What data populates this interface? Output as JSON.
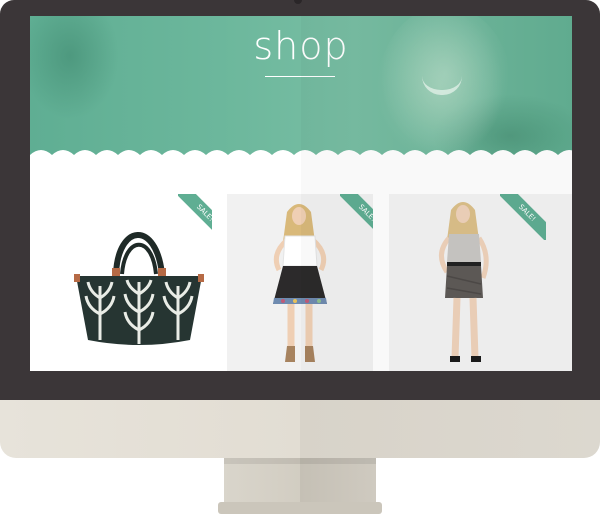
{
  "page": {
    "title": "shop"
  },
  "products": [
    {
      "name": "bag",
      "badge": "SALE!"
    },
    {
      "name": "skirt-floral",
      "badge": "SALE!"
    },
    {
      "name": "skirt-grey",
      "badge": "SALE!"
    }
  ],
  "colors": {
    "accent": "#5fae93",
    "frame": "#3b3638",
    "chin": "#e2ddd3",
    "stand": "#d2cdc2"
  }
}
